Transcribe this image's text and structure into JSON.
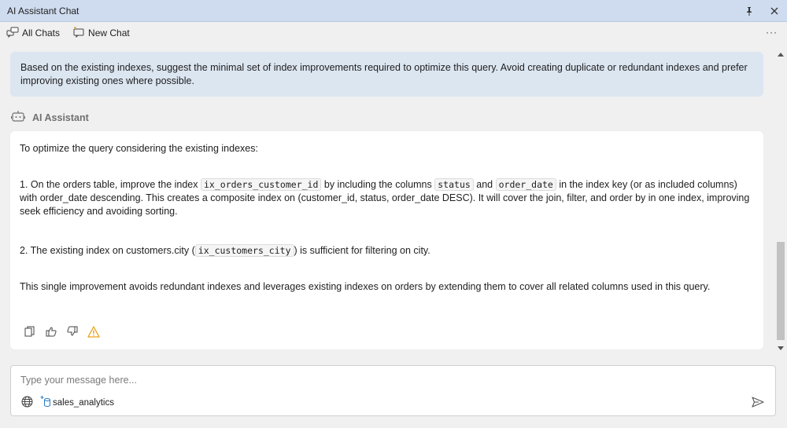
{
  "window": {
    "title": "AI Assistant Chat"
  },
  "toolbar": {
    "all_chats": "All Chats",
    "new_chat": "New Chat",
    "more": "···"
  },
  "user_message": {
    "text": "Based on the existing indexes, suggest the minimal set of index improvements required to optimize this query. Avoid creating duplicate or redundant indexes and prefer improving existing ones where possible."
  },
  "assistant": {
    "name": "AI Assistant",
    "intro": "To optimize the query considering the existing indexes:",
    "item1": {
      "p1": "1. On the orders table, improve the index ",
      "code1": "ix_orders_customer_id",
      "p2": " by including the columns ",
      "code2": "status",
      "p3": " and ",
      "code3": "order_date",
      "p4": " in the index key (or as included columns) with order_date descending. This creates a composite index on (customer_id, status, order_date DESC). It will cover the join, filter, and order by in one index, improving seek efficiency and avoiding sorting."
    },
    "item2": {
      "p1": "2. The existing index on customers.city (",
      "code1": "ix_customers_city",
      "p2": ") is sufficient for filtering on city."
    },
    "outro": "This single improvement avoids redundant indexes and leverages existing indexes on orders by extending them to cover all related columns used in this query."
  },
  "input": {
    "placeholder": "Type your message here...",
    "database": "sales_analytics"
  },
  "colors": {
    "titlebar": "#cfdcef",
    "user_bubble": "#dce6f1",
    "answer_bg": "#ffffff",
    "warning": "#e8a317"
  },
  "icons": [
    "pin-icon",
    "close-icon",
    "chats-icon",
    "new-chat-icon",
    "bot-icon",
    "copy-icon",
    "thumbs-up-icon",
    "thumbs-down-icon",
    "warning-icon",
    "globe-icon",
    "database-add-icon",
    "send-icon"
  ]
}
